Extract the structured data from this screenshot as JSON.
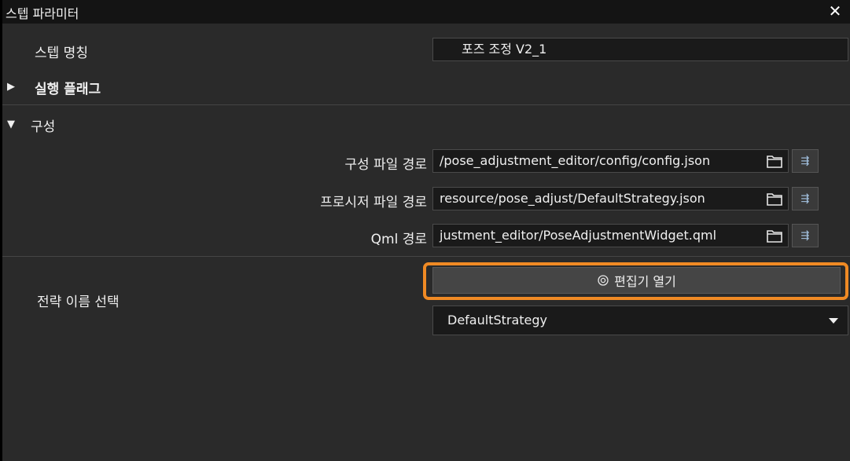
{
  "window": {
    "title": "스텝 파라미터",
    "close_icon": "close-icon"
  },
  "step_name": {
    "label": "스텝 명칭",
    "value": "포즈 조정 V2_1"
  },
  "run_flags": {
    "label": "실행 플래그",
    "expanded": false
  },
  "config": {
    "label": "구성",
    "expanded": true,
    "config_path": {
      "label": "구성 파일 경로",
      "value": "/pose_adjustment_editor/config/config.json"
    },
    "procedure_path": {
      "label": "프로시저 파일 경로",
      "value": "resource/pose_adjust/DefaultStrategy.json"
    },
    "qml_path": {
      "label": "Qml 경로",
      "value": "justment_editor/PoseAdjustmentWidget.qml"
    }
  },
  "strategy": {
    "label": "전략 이름 선택",
    "open_editor_label": "편집기 열기",
    "open_editor_icon": "gear-icon",
    "selected": "DefaultStrategy"
  },
  "colors": {
    "highlight": "#f08a24",
    "background": "#2a2a2a",
    "field": "#1a1a1a"
  }
}
